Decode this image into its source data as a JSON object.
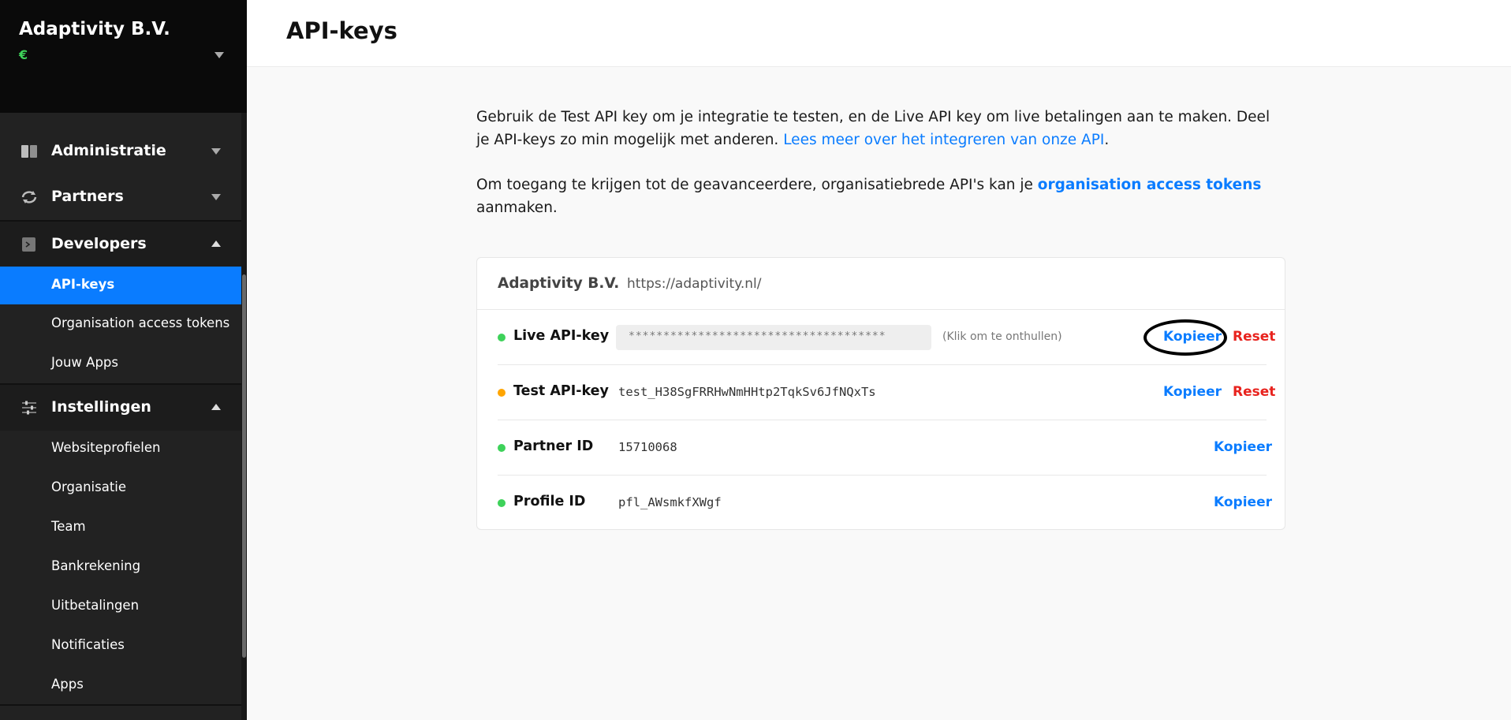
{
  "sidebar": {
    "org_name": "Adaptivity B.V.",
    "currency": "€",
    "groups": {
      "administratie": {
        "label": "Administratie",
        "icon": "book-icon"
      },
      "partners": {
        "label": "Partners",
        "icon": "sync-icon"
      },
      "developers": {
        "label": "Developers",
        "icon": "terminal-icon",
        "items": [
          "API-keys",
          "Organisation access tokens",
          "Jouw Apps"
        ]
      },
      "instellingen": {
        "label": "Instellingen",
        "icon": "sliders-icon",
        "items": [
          "Websiteprofielen",
          "Organisatie",
          "Team",
          "Bankrekening",
          "Uitbetalingen",
          "Notificaties",
          "Apps"
        ]
      }
    },
    "active_item": "API-keys"
  },
  "header": {
    "title": "API-keys"
  },
  "intro": {
    "p1_text": "Gebruik de Test API key om je integratie te testen, en de Live API key om live betalingen aan te maken. Deel je API-keys zo min mogelijk met anderen. ",
    "p1_link": "Lees meer over het integreren van onze API",
    "p1_end": ".",
    "p2_text": "Om toegang te krijgen tot de geavanceerdere, organisatiebrede API's kan je ",
    "p2_link": "organisation access tokens",
    "p2_end": " aanmaken."
  },
  "card": {
    "org_name": "Adaptivity B.V.",
    "url": "https://adaptivity.nl/",
    "rows": [
      {
        "label": "Live API-key",
        "status_color": "#3ed25a",
        "masked_value": "*************************************",
        "hint": "(Klik om te onthullen)",
        "copy": "Kopieer",
        "reset": "Reset"
      },
      {
        "label": "Test API-key",
        "status_color": "#ffa500",
        "value": "test_H38SgFRRHwNmHHtp2TqkSv6JfNQxTs",
        "copy": "Kopieer",
        "reset": "Reset"
      },
      {
        "label": "Partner ID",
        "status_color": "#3ed25a",
        "value": "15710068",
        "copy": "Kopieer"
      },
      {
        "label": "Profile ID",
        "status_color": "#3ed25a",
        "value": "pfl_AWsmkfXWgf",
        "copy": "Kopieer"
      }
    ]
  },
  "colors": {
    "accent": "#0a7cff",
    "danger": "#e8231e",
    "sidebar_bg": "#222222",
    "status_live": "#3ed25a",
    "status_test": "#ffa500"
  }
}
